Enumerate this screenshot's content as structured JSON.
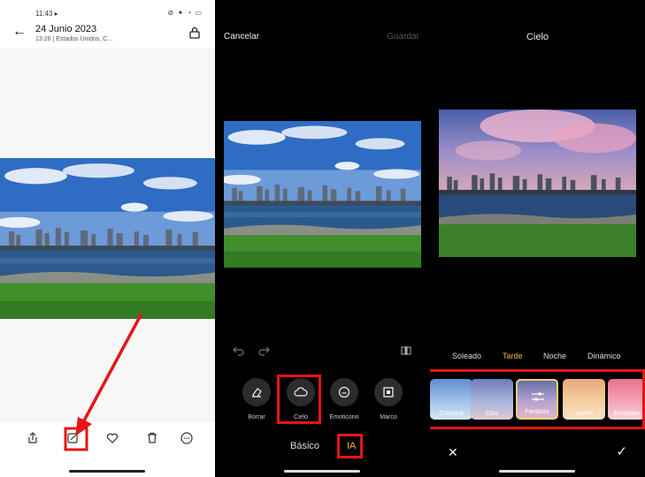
{
  "panel1": {
    "status_time": "11:43 ▸",
    "status_icons": "⊘ ✦ ◔ ▭",
    "date": "24 Junio 2023",
    "subtitle": "13:26 | Estados Unidos, C..."
  },
  "panel2": {
    "cancel_label": "Cancelar",
    "save_label": "Guardar",
    "tools": [
      {
        "label": "Borrar",
        "icon": "eraser-icon"
      },
      {
        "label": "Cielo",
        "icon": "cloud-icon"
      },
      {
        "label": "Emoticono",
        "icon": "emoji-icon"
      },
      {
        "label": "Marco",
        "icon": "frame-icon"
      }
    ],
    "tabs": {
      "basic": "Básico",
      "ai": "IA"
    }
  },
  "panel3": {
    "title": "Cielo",
    "categories": [
      "Soleado",
      "Tarde",
      "Noche",
      "Dinámico"
    ],
    "active_category": "Tarde",
    "skies": [
      "Cúmulus",
      "Olas",
      "Fantasía",
      "Sueño",
      "Escarlata"
    ],
    "selected_sky": "Fantasía"
  },
  "colors": {
    "accent": "#f0b938",
    "annotation": "#e51515"
  }
}
